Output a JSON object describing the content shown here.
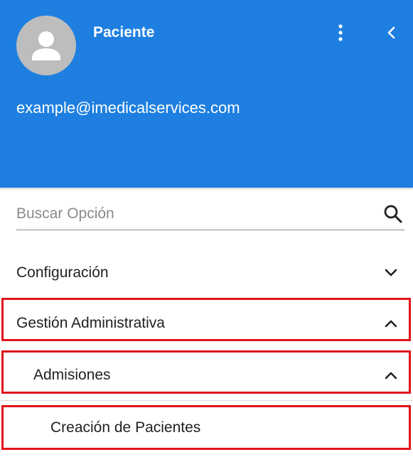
{
  "header": {
    "user_name": "Paciente",
    "user_email": "example@imedicalservices.com",
    "bg_color": "#1e7fe0"
  },
  "search": {
    "placeholder": "Buscar Opción",
    "value": ""
  },
  "menu": {
    "items": [
      {
        "label": "Configuración",
        "state": "collapsed",
        "level": 0
      },
      {
        "label": "Gestión Administrativa",
        "state": "expanded",
        "level": 0
      },
      {
        "label": "Admisiones",
        "state": "expanded",
        "level": 1
      },
      {
        "label": "Creación de Pacientes",
        "level": 2
      }
    ]
  },
  "highlight_color": "#e0141b",
  "icons": [
    "person-icon",
    "more-vert-icon",
    "chevron-left-icon",
    "search-icon",
    "chevron-down-icon",
    "chevron-up-icon"
  ]
}
